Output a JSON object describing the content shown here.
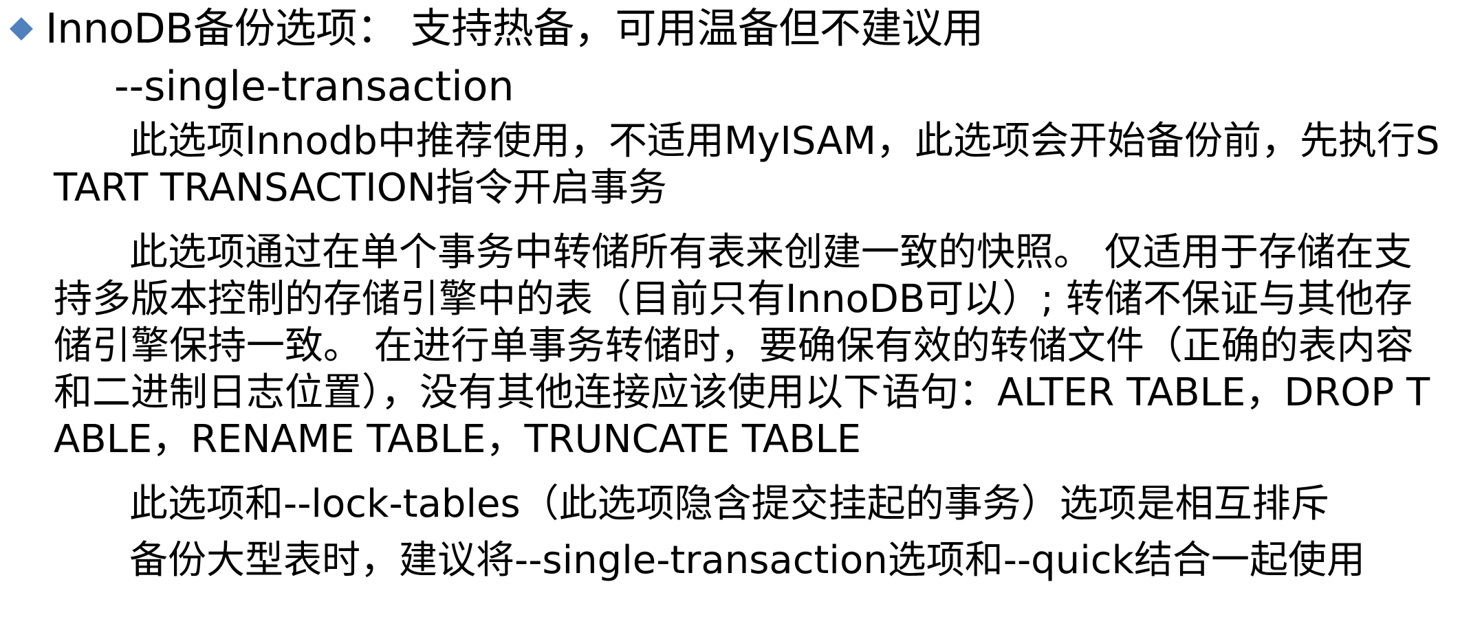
{
  "bullet": {
    "icon": "diamond-bullet-icon",
    "color": "#4f81bd",
    "text": "InnoDB备份选项： 支持热备，可用温备但不建议用"
  },
  "option_name": "--single-transaction",
  "paragraphs": [
    "此选项Innodb中推荐使用，不适用MyISAM，此选项会开始备份前，先执行START TRANSACTION指令开启事务",
    "此选项通过在单个事务中转储所有表来创建一致的快照。 仅适用于存储在支持多版本控制的存储引擎中的表（目前只有InnoDB可以）; 转储不保证与其他存储引擎保持一致。 在进行单事务转储时，要确保有效的转储文件（正确的表内容和二进制日志位置），没有其他连接应该使用以下语句：ALTER TABLE，DROP TABLE，RENAME TABLE，TRUNCATE TABLE",
    "此选项和--lock-tables（此选项隐含提交挂起的事务）选项是相互排斥",
    "备份大型表时，建议将--single-transaction选项和--quick结合一起使用"
  ]
}
